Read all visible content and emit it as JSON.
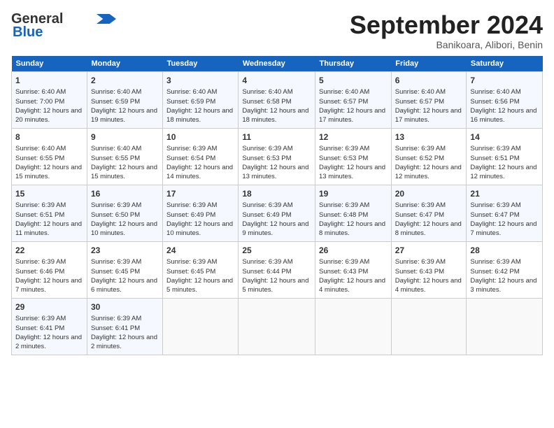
{
  "header": {
    "logo_general": "General",
    "logo_blue": "Blue",
    "month_title": "September 2024",
    "location": "Banikoara, Alibori, Benin"
  },
  "days_of_week": [
    "Sunday",
    "Monday",
    "Tuesday",
    "Wednesday",
    "Thursday",
    "Friday",
    "Saturday"
  ],
  "weeks": [
    [
      {
        "day": "1",
        "sunrise": "Sunrise: 6:40 AM",
        "sunset": "Sunset: 7:00 PM",
        "daylight": "Daylight: 12 hours and 20 minutes."
      },
      {
        "day": "2",
        "sunrise": "Sunrise: 6:40 AM",
        "sunset": "Sunset: 6:59 PM",
        "daylight": "Daylight: 12 hours and 19 minutes."
      },
      {
        "day": "3",
        "sunrise": "Sunrise: 6:40 AM",
        "sunset": "Sunset: 6:59 PM",
        "daylight": "Daylight: 12 hours and 18 minutes."
      },
      {
        "day": "4",
        "sunrise": "Sunrise: 6:40 AM",
        "sunset": "Sunset: 6:58 PM",
        "daylight": "Daylight: 12 hours and 18 minutes."
      },
      {
        "day": "5",
        "sunrise": "Sunrise: 6:40 AM",
        "sunset": "Sunset: 6:57 PM",
        "daylight": "Daylight: 12 hours and 17 minutes."
      },
      {
        "day": "6",
        "sunrise": "Sunrise: 6:40 AM",
        "sunset": "Sunset: 6:57 PM",
        "daylight": "Daylight: 12 hours and 17 minutes."
      },
      {
        "day": "7",
        "sunrise": "Sunrise: 6:40 AM",
        "sunset": "Sunset: 6:56 PM",
        "daylight": "Daylight: 12 hours and 16 minutes."
      }
    ],
    [
      {
        "day": "8",
        "sunrise": "Sunrise: 6:40 AM",
        "sunset": "Sunset: 6:55 PM",
        "daylight": "Daylight: 12 hours and 15 minutes."
      },
      {
        "day": "9",
        "sunrise": "Sunrise: 6:40 AM",
        "sunset": "Sunset: 6:55 PM",
        "daylight": "Daylight: 12 hours and 15 minutes."
      },
      {
        "day": "10",
        "sunrise": "Sunrise: 6:39 AM",
        "sunset": "Sunset: 6:54 PM",
        "daylight": "Daylight: 12 hours and 14 minutes."
      },
      {
        "day": "11",
        "sunrise": "Sunrise: 6:39 AM",
        "sunset": "Sunset: 6:53 PM",
        "daylight": "Daylight: 12 hours and 13 minutes."
      },
      {
        "day": "12",
        "sunrise": "Sunrise: 6:39 AM",
        "sunset": "Sunset: 6:53 PM",
        "daylight": "Daylight: 12 hours and 13 minutes."
      },
      {
        "day": "13",
        "sunrise": "Sunrise: 6:39 AM",
        "sunset": "Sunset: 6:52 PM",
        "daylight": "Daylight: 12 hours and 12 minutes."
      },
      {
        "day": "14",
        "sunrise": "Sunrise: 6:39 AM",
        "sunset": "Sunset: 6:51 PM",
        "daylight": "Daylight: 12 hours and 12 minutes."
      }
    ],
    [
      {
        "day": "15",
        "sunrise": "Sunrise: 6:39 AM",
        "sunset": "Sunset: 6:51 PM",
        "daylight": "Daylight: 12 hours and 11 minutes."
      },
      {
        "day": "16",
        "sunrise": "Sunrise: 6:39 AM",
        "sunset": "Sunset: 6:50 PM",
        "daylight": "Daylight: 12 hours and 10 minutes."
      },
      {
        "day": "17",
        "sunrise": "Sunrise: 6:39 AM",
        "sunset": "Sunset: 6:49 PM",
        "daylight": "Daylight: 12 hours and 10 minutes."
      },
      {
        "day": "18",
        "sunrise": "Sunrise: 6:39 AM",
        "sunset": "Sunset: 6:49 PM",
        "daylight": "Daylight: 12 hours and 9 minutes."
      },
      {
        "day": "19",
        "sunrise": "Sunrise: 6:39 AM",
        "sunset": "Sunset: 6:48 PM",
        "daylight": "Daylight: 12 hours and 8 minutes."
      },
      {
        "day": "20",
        "sunrise": "Sunrise: 6:39 AM",
        "sunset": "Sunset: 6:47 PM",
        "daylight": "Daylight: 12 hours and 8 minutes."
      },
      {
        "day": "21",
        "sunrise": "Sunrise: 6:39 AM",
        "sunset": "Sunset: 6:47 PM",
        "daylight": "Daylight: 12 hours and 7 minutes."
      }
    ],
    [
      {
        "day": "22",
        "sunrise": "Sunrise: 6:39 AM",
        "sunset": "Sunset: 6:46 PM",
        "daylight": "Daylight: 12 hours and 7 minutes."
      },
      {
        "day": "23",
        "sunrise": "Sunrise: 6:39 AM",
        "sunset": "Sunset: 6:45 PM",
        "daylight": "Daylight: 12 hours and 6 minutes."
      },
      {
        "day": "24",
        "sunrise": "Sunrise: 6:39 AM",
        "sunset": "Sunset: 6:45 PM",
        "daylight": "Daylight: 12 hours and 5 minutes."
      },
      {
        "day": "25",
        "sunrise": "Sunrise: 6:39 AM",
        "sunset": "Sunset: 6:44 PM",
        "daylight": "Daylight: 12 hours and 5 minutes."
      },
      {
        "day": "26",
        "sunrise": "Sunrise: 6:39 AM",
        "sunset": "Sunset: 6:43 PM",
        "daylight": "Daylight: 12 hours and 4 minutes."
      },
      {
        "day": "27",
        "sunrise": "Sunrise: 6:39 AM",
        "sunset": "Sunset: 6:43 PM",
        "daylight": "Daylight: 12 hours and 4 minutes."
      },
      {
        "day": "28",
        "sunrise": "Sunrise: 6:39 AM",
        "sunset": "Sunset: 6:42 PM",
        "daylight": "Daylight: 12 hours and 3 minutes."
      }
    ],
    [
      {
        "day": "29",
        "sunrise": "Sunrise: 6:39 AM",
        "sunset": "Sunset: 6:41 PM",
        "daylight": "Daylight: 12 hours and 2 minutes."
      },
      {
        "day": "30",
        "sunrise": "Sunrise: 6:39 AM",
        "sunset": "Sunset: 6:41 PM",
        "daylight": "Daylight: 12 hours and 2 minutes."
      },
      null,
      null,
      null,
      null,
      null
    ]
  ]
}
